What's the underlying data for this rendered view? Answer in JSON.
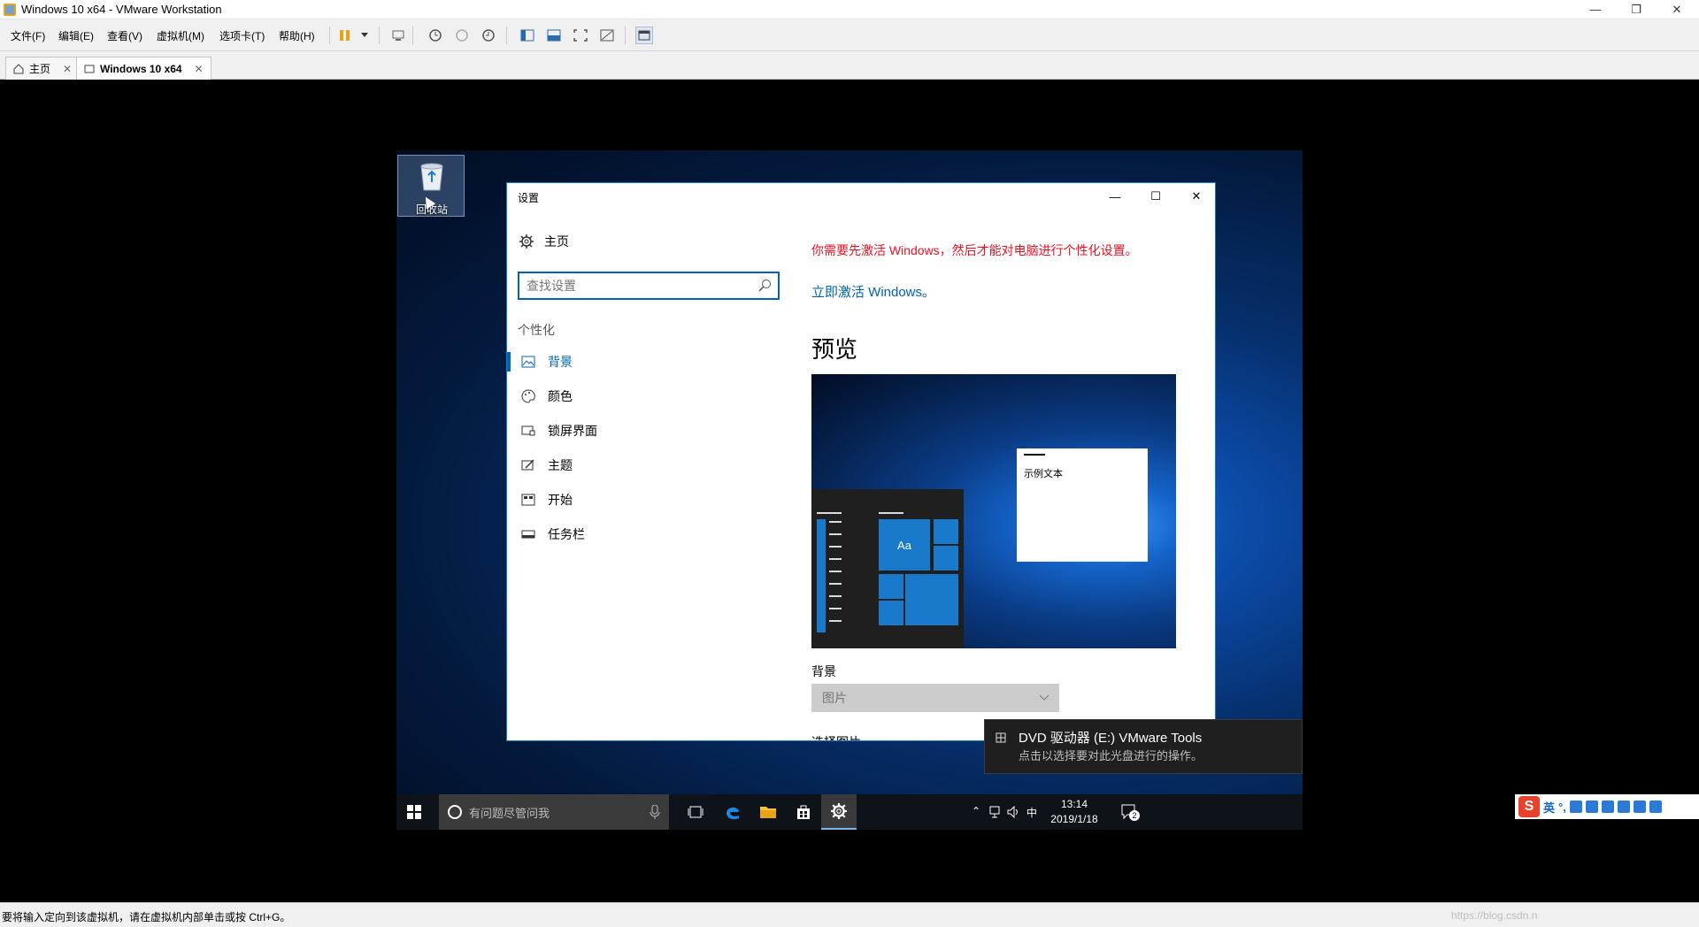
{
  "window": {
    "title": "Windows 10 x64 - VMware Workstation"
  },
  "menu": [
    "文件(F)",
    "编辑(E)",
    "查看(V)",
    "虚拟机(M)",
    "选项卡(T)",
    "帮助(H)"
  ],
  "tabs": [
    {
      "label": "主页",
      "active": false
    },
    {
      "label": "Windows 10 x64",
      "active": true
    }
  ],
  "desktop": {
    "recycle_bin_label": "回收站"
  },
  "settings": {
    "title": "设置",
    "home_label": "主页",
    "search_placeholder": "查找设置",
    "section": "个性化",
    "nav": [
      {
        "label": "背景",
        "icon": "image-icon",
        "active": true
      },
      {
        "label": "颜色",
        "icon": "palette-icon",
        "active": false
      },
      {
        "label": "锁屏界面",
        "icon": "lock-screen-icon",
        "active": false
      },
      {
        "label": "主题",
        "icon": "theme-icon",
        "active": false
      },
      {
        "label": "开始",
        "icon": "start-icon",
        "active": false
      },
      {
        "label": "任务栏",
        "icon": "taskbar-icon",
        "active": false
      }
    ],
    "warning": "你需要先激活 Windows，然后才能对电脑进行个性化设置。",
    "activate_link": "立即激活 Windows。",
    "preview_title": "预览",
    "sample_text": "示例文本",
    "tile_text": "Aa",
    "background_label": "背景",
    "background_value": "图片",
    "choose_picture": "选择图片"
  },
  "toast": {
    "title": "DVD 驱动器 (E:) VMware Tools",
    "body": "点击以选择要对此光盘进行的操作。"
  },
  "taskbar": {
    "search_placeholder": "有问题尽管问我",
    "ime_char": "中",
    "time": "13:14",
    "date": "2019/1/18",
    "notification_count": "2"
  },
  "host_ime": {
    "lang": "英"
  },
  "statusbar": {
    "message": "要将输入定向到该虚拟机，请在虚拟机内部单击或按 Ctrl+G。",
    "watermark": "https://blog.csdn.n"
  },
  "colors": {
    "accent": "#0063b1",
    "warning": "#e81123",
    "taskbar": "#0e1219"
  }
}
